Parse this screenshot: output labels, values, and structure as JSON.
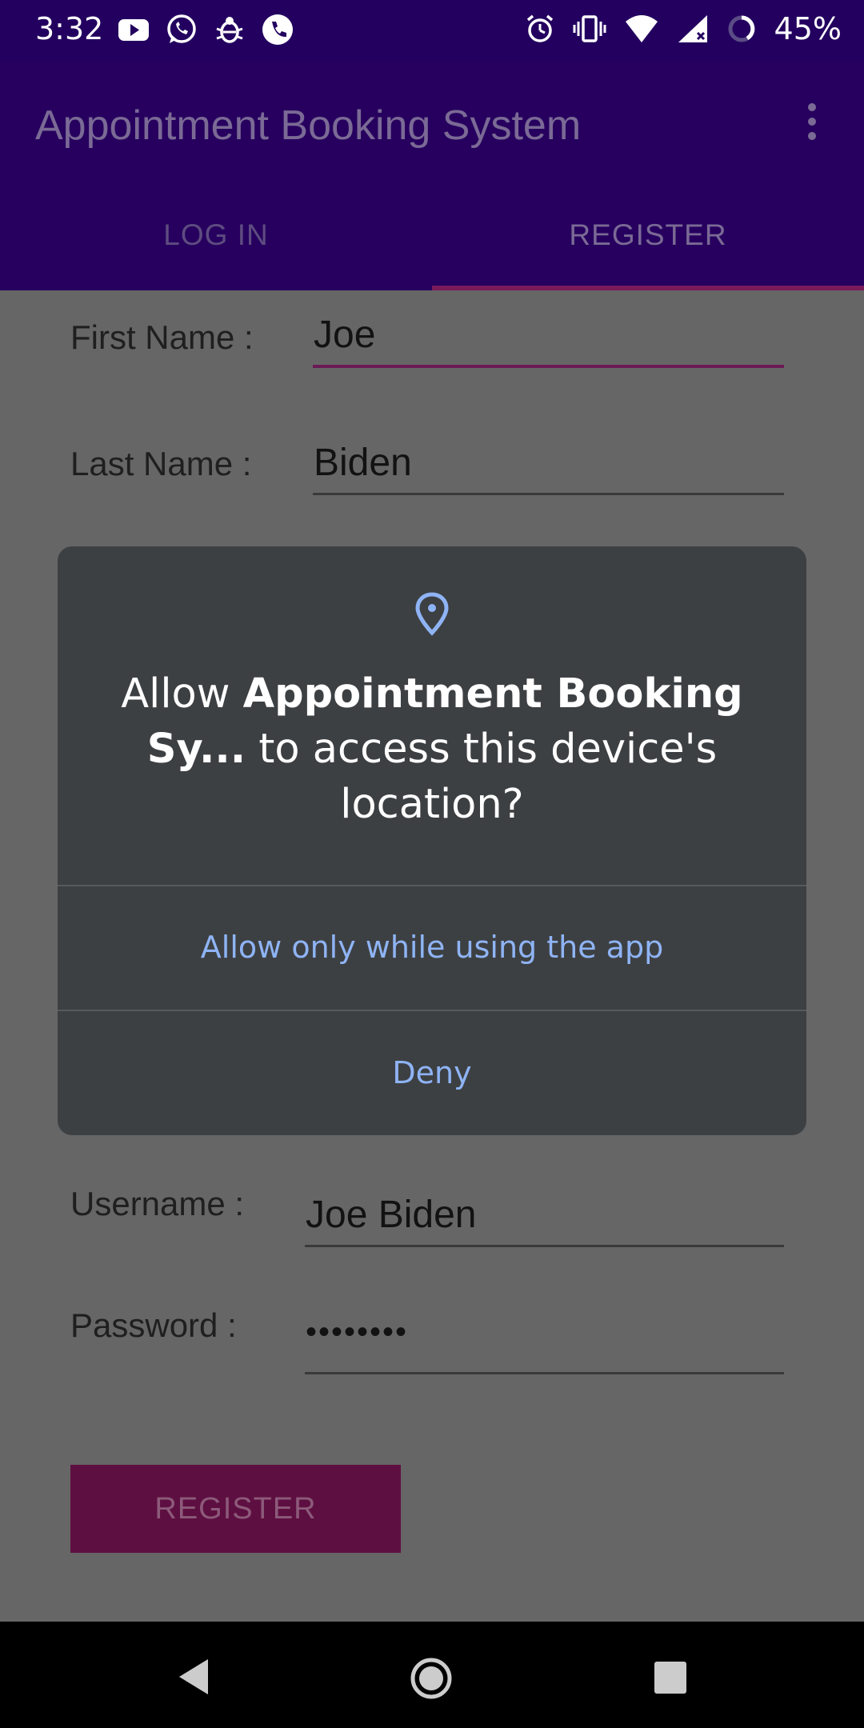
{
  "status_bar": {
    "time": "3:32",
    "battery": "45%",
    "left_icons": [
      "youtube-icon",
      "whatsapp-icon",
      "bug-icon",
      "phone-icon"
    ],
    "right_icons": [
      "alarm-icon",
      "vibrate-icon",
      "wifi-icon",
      "signal-icon",
      "battery-icon"
    ]
  },
  "app_bar": {
    "title": "Appointment Booking System",
    "overflow_icon": "more-vert-icon"
  },
  "tabs": [
    {
      "label": "LOG IN",
      "selected": false
    },
    {
      "label": "REGISTER",
      "selected": true
    }
  ],
  "form": {
    "first_name_label": "First Name :",
    "first_name_value": "Joe",
    "last_name_label": "Last Name :",
    "last_name_value": "Biden",
    "username_label": "Username :",
    "username_value": "Joe Biden",
    "password_label": "Password :",
    "password_value": "••••••••",
    "register_button": "REGISTER"
  },
  "dialog": {
    "icon": "location-pin-icon",
    "title_prefix": "Allow ",
    "title_app": "Appointment Booking Sy...",
    "title_suffix": " to access this device's location?",
    "allow_button": "Allow only while using the app",
    "deny_button": "Deny"
  },
  "colors": {
    "status_bar": "#23005f",
    "app_bar": "#27005f",
    "accent": "#7a1a5a",
    "dialog_bg": "#3d4043",
    "dialog_link": "#8fb4f5"
  },
  "nav_bar": {
    "back_icon": "back-triangle-icon",
    "home_icon": "home-circle-icon",
    "recents_icon": "recents-square-icon"
  }
}
